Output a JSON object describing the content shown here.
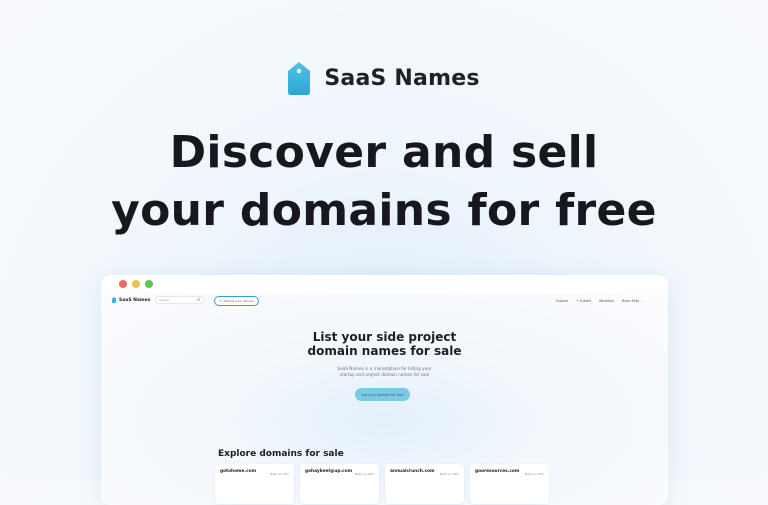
{
  "brand": {
    "name": "SaaS Names",
    "logo_icon": "tag-icon",
    "accent": "#3fb6dd"
  },
  "hero": {
    "line1": "Discover and sell",
    "line2": "your domains for free"
  },
  "browser": {
    "nav": {
      "logo_text": "SaaS Names",
      "search_placeholder": "Search",
      "cta_label": "Submit your domain",
      "links": [
        "Explore",
        "+ Submit",
        "Advertise"
      ],
      "user": "Bram Eelfs"
    },
    "content": {
      "title_line1": "List your side project",
      "title_line2": "domain names for sale",
      "desc_line1": "SaaS Names is a marketplace for listing your",
      "desc_line2": "startup and project domain names for sale",
      "button": "List your domain for free"
    },
    "explore": {
      "title": "Explore domains for sale",
      "cards": [
        {
          "domain": "gotohome.com",
          "offer": "Make an offer"
        },
        {
          "domain": "gohaybeel@up.com",
          "offer": "Make an offer"
        },
        {
          "domain": "annualcrunch.com",
          "offer": "Make an offer"
        },
        {
          "domain": "gooresources.com",
          "offer": "Make an offer"
        }
      ]
    }
  }
}
